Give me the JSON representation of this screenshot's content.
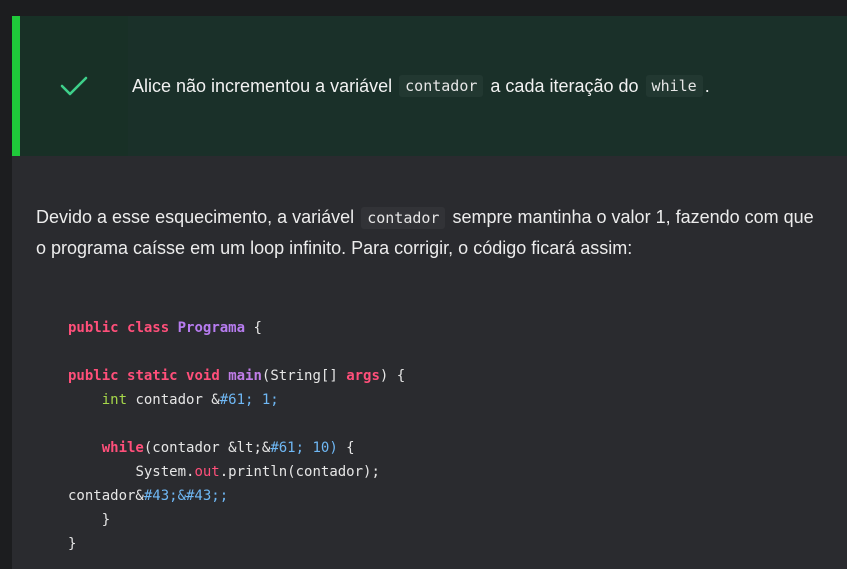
{
  "feedback": {
    "icon": "check-icon",
    "accent_color": "#1fc93a",
    "text_before": "Alice não incrementou a variável",
    "code_1": "contador",
    "text_middle": "a cada iteração do",
    "code_2": "while",
    "text_after": "."
  },
  "explanation": {
    "text_before": "Devido a esse esquecimento, a variável",
    "code": "contador",
    "text_after": "sempre mantinha o valor 1, fazendo com que o programa caísse em um loop infinito. Para corrigir, o código ficará assim:"
  },
  "code": {
    "l1": {
      "kw1": "public",
      "kw2": "class",
      "cls": "Programa",
      "rest": " {"
    },
    "l3": {
      "kw1": "public",
      "kw2": "static",
      "kw3": "void",
      "fn": "main",
      "rest1": "(String[] ",
      "arg": "args",
      "rest2": ") {"
    },
    "l4": {
      "indent": "    ",
      "type": "int",
      "rest": " contador &",
      "num": "#61; 1;"
    },
    "l6": {
      "indent": "    ",
      "kw": "while",
      "rest": "(contador &lt;&",
      "num": "#61; 10)",
      "rest2": " {"
    },
    "l7": {
      "indent": "        ",
      "obj": "System.",
      "field": "out",
      "rest": ".println(contador);"
    },
    "l8": {
      "pre": "contador&",
      "num": "#43;&#43;;"
    },
    "l9": {
      "text": "    }"
    },
    "l10": {
      "text": "}"
    }
  }
}
